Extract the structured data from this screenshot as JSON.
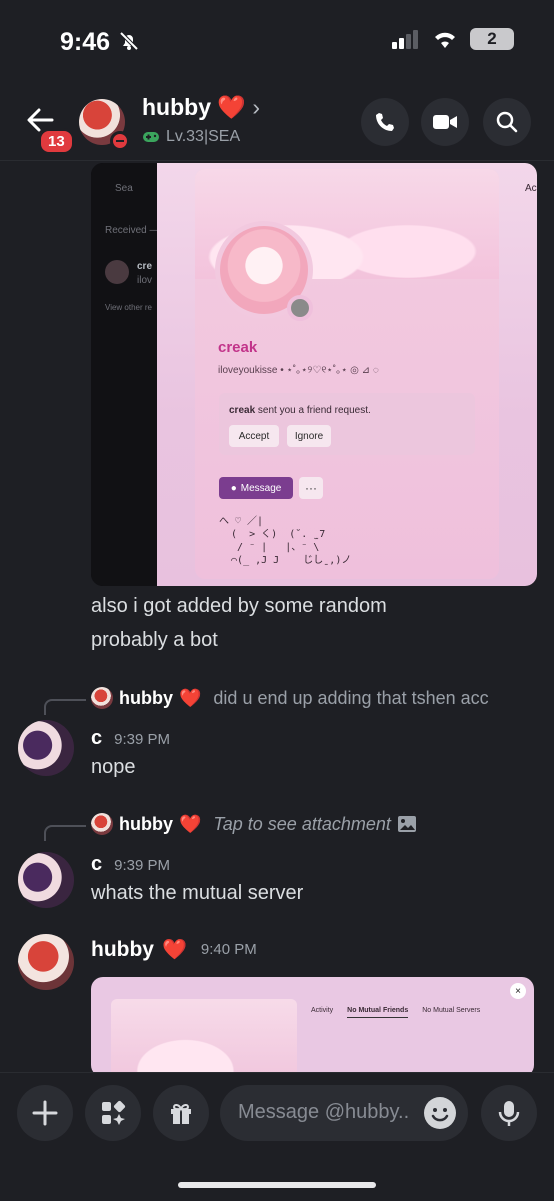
{
  "status_bar": {
    "time": "9:46",
    "battery": "2"
  },
  "header": {
    "unread_count": "13",
    "name": "hubby",
    "name_heart": "❤️",
    "subtitle": "Lv.33|SEA"
  },
  "attachment1": {
    "left_dark": {
      "search": "Sea",
      "received": "Received —",
      "list_name": "cre",
      "list_sub": "ilov",
      "view_other": "View other re"
    },
    "tab_label": "Ac",
    "profile_name": "creak",
    "profile_tag": "iloveyoukisse • ⋆˚｡⋆୨♡୧⋆˚｡⋆ ◎ ⊿ ◌",
    "request_name": "creak",
    "request_text": " sent you a friend request.",
    "accept": "Accept",
    "ignore": "Ignore",
    "message": "Message",
    "more": "···",
    "kaomoji": "へ ♡ ／|\n  (  > く)  (˘. ̫ 7\n   / ⁻ |   |、⁻ \\\n  ⌒(_ ,J J    じしˍ,)ノ"
  },
  "messages": {
    "m1_line1": "also i got added by some random",
    "m1_line2": "probably a bot",
    "reply1_name": "hubby",
    "reply1_heart": "❤️",
    "reply1_text": "did u end up adding that tshen acc",
    "c1_author": "c",
    "c1_time": "9:39 PM",
    "c1_text": "nope",
    "reply2_name": "hubby",
    "reply2_heart": "❤️",
    "reply2_text": "Tap to see attachment",
    "c2_author": "c",
    "c2_time": "9:39 PM",
    "c2_text": "whats the mutual server",
    "h_author": "hubby",
    "h_heart": "❤️",
    "h_time": "9:40 PM"
  },
  "attachment2": {
    "tabs": [
      "Activity",
      "No Mutual Friends",
      "No Mutual Servers"
    ],
    "close": "×"
  },
  "composer": {
    "placeholder": "Message @hubby.."
  }
}
